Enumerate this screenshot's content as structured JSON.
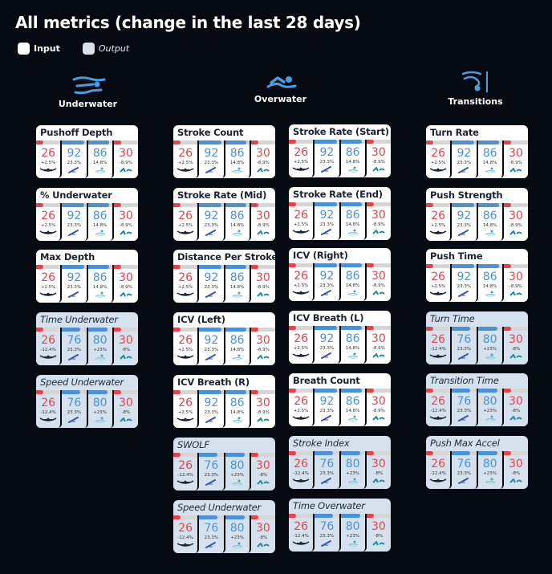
{
  "header": {
    "title": "All metrics (change in the last 28 days)",
    "legend": [
      {
        "label": "Input",
        "kind": "input"
      },
      {
        "label": "Output",
        "kind": "output"
      }
    ]
  },
  "colors": {
    "background": "#060a12",
    "input_card": "#ffffff",
    "output_card": "#d5e2ee",
    "negative": "#e4434e",
    "positive": "#4a91d8",
    "bar_track": "#d6d6d6"
  },
  "cell_icons": [
    "swimmer-front-icon",
    "swimmer-dive-icon",
    "swimmer-surface-icon",
    "swimmer-kick-icon"
  ],
  "input_cells": [
    {
      "value": "26",
      "change": "+2.5%",
      "fill": 0.26,
      "tone": "red"
    },
    {
      "value": "92",
      "change": "23.3%",
      "fill": 0.92,
      "tone": "blue"
    },
    {
      "value": "86",
      "change": "14.8%",
      "fill": 0.86,
      "tone": "blue"
    },
    {
      "value": "30",
      "change": "-8.9%",
      "fill": 0.3,
      "tone": "red"
    }
  ],
  "output_cells": [
    {
      "value": "26",
      "change": "-12.4%",
      "fill": 0.26,
      "tone": "red"
    },
    {
      "value": "76",
      "change": "23.3%",
      "fill": 0.76,
      "tone": "blue"
    },
    {
      "value": "80",
      "change": "+23%",
      "fill": 0.8,
      "tone": "blue"
    },
    {
      "value": "30",
      "change": "-8%",
      "fill": 0.3,
      "tone": "red"
    }
  ],
  "columns": [
    {
      "label": "Underwater",
      "icon": "underwater-swimmer-icon",
      "cards": [
        {
          "title": "Pushoff Depth",
          "kind": "input"
        },
        {
          "title": "% Underwater",
          "kind": "input"
        },
        {
          "title": "Max Depth",
          "kind": "input"
        },
        {
          "title": "Time Underwater",
          "kind": "output"
        },
        {
          "title": "Speed Underwater",
          "kind": "output"
        }
      ]
    },
    {
      "label": "Overwater",
      "icon": "overwater-swimmer-icon",
      "cards_left": [
        {
          "title": "Stroke Count",
          "kind": "input"
        },
        {
          "title": "Stroke Rate (Mid)",
          "kind": "input"
        },
        {
          "title": "Distance Per Stroke",
          "kind": "input"
        },
        {
          "title": "ICV (Left)",
          "kind": "input"
        },
        {
          "title": "ICV Breath (R)",
          "kind": "input"
        },
        {
          "title": "SWOLF",
          "kind": "output"
        },
        {
          "title": "Speed Underwater",
          "kind": "output"
        }
      ],
      "cards_right": [
        {
          "title": "Stroke Rate (Start)",
          "kind": "input"
        },
        {
          "title": "Stroke Rate (End)",
          "kind": "input"
        },
        {
          "title": "ICV (Right)",
          "kind": "input"
        },
        {
          "title": "ICV Breath (L)",
          "kind": "input"
        },
        {
          "title": "Breath Count",
          "kind": "input"
        },
        {
          "title": "Stroke Index",
          "kind": "output"
        },
        {
          "title": "Time Overwater",
          "kind": "output"
        }
      ]
    },
    {
      "label": "Transitions",
      "icon": "transition-turn-icon",
      "cards": [
        {
          "title": "Turn Rate",
          "kind": "input"
        },
        {
          "title": "Push Strength",
          "kind": "input"
        },
        {
          "title": "Push Time",
          "kind": "input"
        },
        {
          "title": "Turn Time",
          "kind": "output"
        },
        {
          "title": "Transition Time",
          "kind": "output"
        },
        {
          "title": "Push Max Accel",
          "kind": "output"
        }
      ]
    }
  ]
}
